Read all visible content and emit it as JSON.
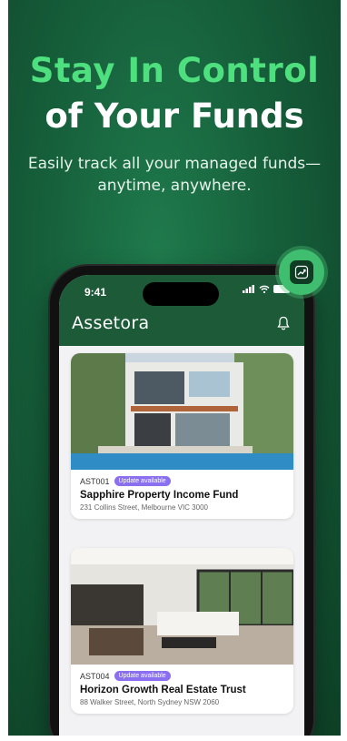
{
  "promo": {
    "title_line1": "Stay In Control",
    "title_line2": "of Your Funds",
    "subtitle_line1": "Easily track all your managed funds—",
    "subtitle_line2": "anytime, anywhere."
  },
  "status_bar": {
    "time": "9:41"
  },
  "app": {
    "brand": "Assetora"
  },
  "funds": [
    {
      "code": "AST001",
      "badge": "Update available",
      "name": "Sapphire Property Income Fund",
      "address": "231 Collins Street, Melbourne VIC 3000"
    },
    {
      "code": "AST004",
      "badge": "Update available",
      "name": "Horizon Growth Real Estate Trust",
      "address": "88 Walker Street, North Sydney NSW 2060"
    }
  ],
  "colors": {
    "accent_green": "#4ee07e",
    "header_green": "#1c5a38",
    "badge_purple": "#8a6ff0"
  },
  "icons": [
    "bell-icon",
    "trend-chart-icon",
    "signal-icon",
    "wifi-icon",
    "battery-icon"
  ]
}
